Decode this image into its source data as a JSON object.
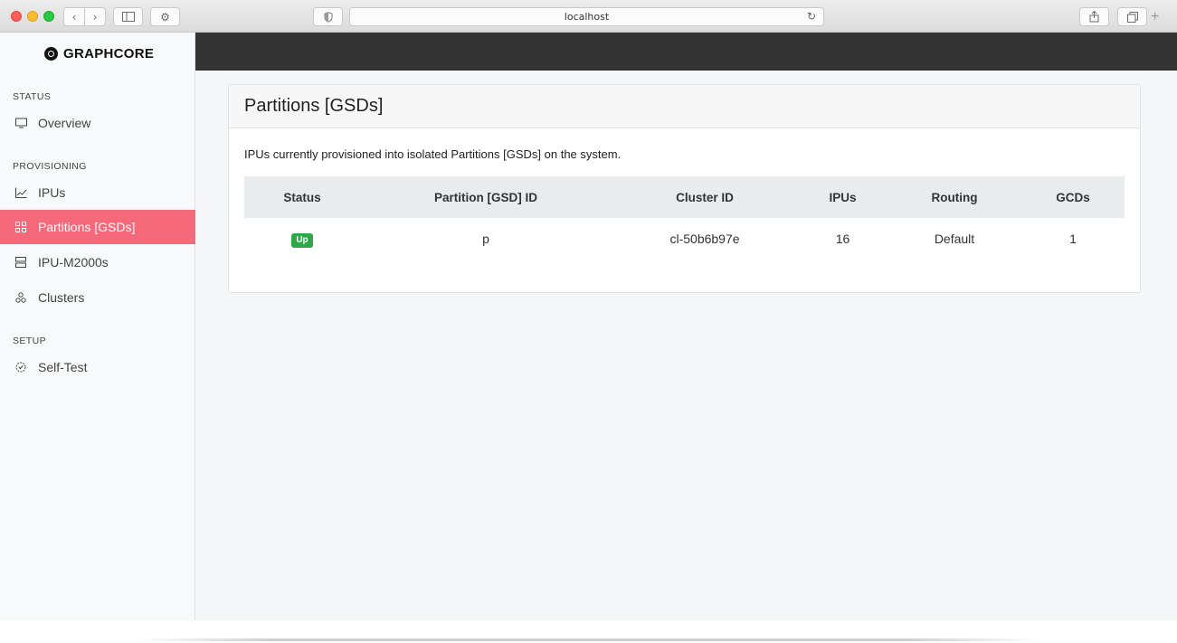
{
  "browser": {
    "address": "localhost",
    "icons": {
      "back": "chevron-left-icon",
      "forward": "chevron-right-icon",
      "sidebar": "sidebar-icon",
      "settings": "gear-icon",
      "reader": "shield-icon",
      "reload": "reload-icon",
      "share": "share-icon",
      "tabs": "tabs-icon",
      "new_tab": "plus-icon"
    }
  },
  "sidebar": {
    "logo": "GRAPHCORE",
    "sections": [
      {
        "label": "STATUS"
      },
      {
        "label": "PROVISIONING"
      },
      {
        "label": "SETUP"
      }
    ],
    "items": [
      {
        "label": "Overview",
        "icon": "monitor-icon"
      },
      {
        "label": "IPUs",
        "icon": "chart-line-icon"
      },
      {
        "label": "Partitions [GSDs]",
        "icon": "partitions-icon",
        "active": true
      },
      {
        "label": "IPU-M2000s",
        "icon": "server-icon"
      },
      {
        "label": "Clusters",
        "icon": "clusters-icon"
      },
      {
        "label": "Self-Test",
        "icon": "self-test-icon"
      }
    ]
  },
  "main": {
    "card": {
      "title": "Partitions [GSDs]",
      "description": "IPUs currently provisioned into isolated Partitions [GSDs] on the system.",
      "table": {
        "headers": [
          "Status",
          "Partition [GSD] ID",
          "Cluster ID",
          "IPUs",
          "Routing",
          "GCDs"
        ],
        "rows": [
          {
            "status": "Up",
            "partition_id": "p",
            "cluster_id": "cl-50b6b97e",
            "ipus": "16",
            "routing": "Default",
            "gcds": "1"
          }
        ]
      }
    }
  },
  "colors": {
    "active_nav": "#f6697a",
    "topbar": "#343434",
    "status_up": "#2fa64a"
  }
}
